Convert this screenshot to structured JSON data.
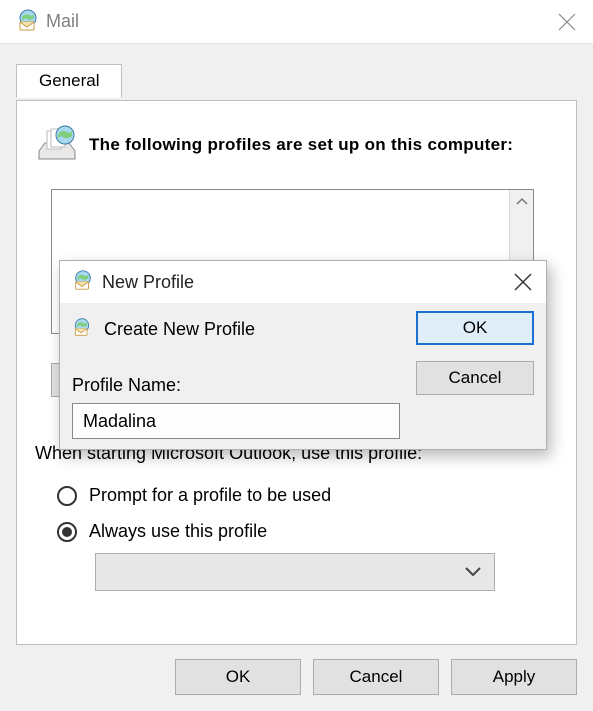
{
  "window": {
    "title": "Mail"
  },
  "tab": {
    "general": "General"
  },
  "profiles": {
    "section_text": "The following profiles are set up on this computer:"
  },
  "use_profile": {
    "label": "When starting Microsoft Outlook, use this profile:",
    "prompt": "Prompt for a profile to be used",
    "always": "Always use this profile",
    "selected": "always"
  },
  "footer": {
    "ok": "OK",
    "cancel": "Cancel",
    "apply": "Apply"
  },
  "modal": {
    "title": "New Profile",
    "heading": "Create New Profile",
    "name_label": "Profile Name:",
    "name_value": "Madalina",
    "ok": "OK",
    "cancel": "Cancel"
  }
}
